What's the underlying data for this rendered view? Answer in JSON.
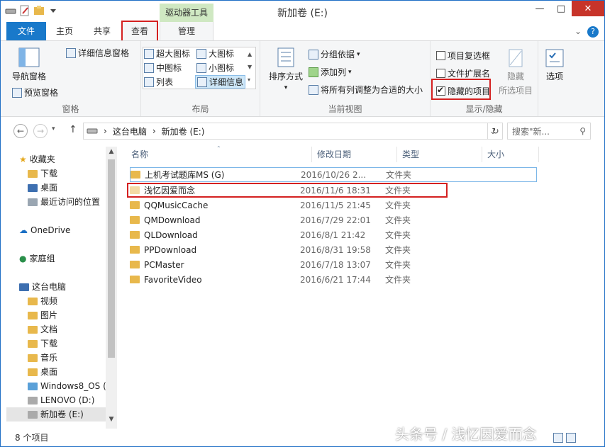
{
  "window": {
    "title": "新加卷 (E:)",
    "context_tab_label": "驱动器工具",
    "minimize": "—",
    "maximize": "□",
    "close": "✕"
  },
  "tabs": {
    "file": "文件",
    "home": "主页",
    "share": "共享",
    "view": "查看",
    "manage": "管理",
    "expand": "⌄",
    "help": "?"
  },
  "ribbon": {
    "panes": {
      "nav_pane": "导航窗格",
      "preview_pane": "预览窗格",
      "details_pane": "详细信息窗格",
      "group": "窗格"
    },
    "layout": {
      "extra_large": "超大图标",
      "large": "大图标",
      "medium": "中图标",
      "small": "小图标",
      "list": "列表",
      "details": "详细信息",
      "group": "布局"
    },
    "current_view": {
      "sort_by": "排序方式",
      "group_by": "分组依据",
      "add_column": "添加列",
      "size_all": "将所有列调整为合适的大小",
      "group": "当前视图"
    },
    "show_hide": {
      "item_checkboxes": "项目复选框",
      "file_extensions": "文件扩展名",
      "hidden_items": "隐藏的项目",
      "hide": "隐藏",
      "selected_items": "所选项目",
      "group": "显示/隐藏",
      "item_checkboxes_checked": false,
      "file_extensions_checked": false,
      "hidden_items_checked": true
    },
    "options": "选项"
  },
  "address": {
    "back": "←",
    "forward": "→",
    "up": "↑",
    "path_root": "这台电脑",
    "path_drive": "新加卷 (E:)",
    "sep": "›",
    "dropdown": "⌄",
    "refresh": "↻",
    "search_placeholder": "搜索\"新...",
    "search_icon": "⚲"
  },
  "nav": {
    "favorites": "收藏夹",
    "downloads": "下载",
    "desktop": "桌面",
    "recent": "最近访问的位置",
    "onedrive": "OneDrive",
    "homegroup": "家庭组",
    "thispc": "这台电脑",
    "videos": "视频",
    "pictures": "图片",
    "documents": "文档",
    "downloads2": "下载",
    "music": "音乐",
    "desktop2": "桌面",
    "win8": "Windows8_OS (",
    "lenovo": "LENOVO (D:)",
    "newvol": "新加卷 (E:)"
  },
  "columns": {
    "name": "名称",
    "date": "修改日期",
    "type": "类型",
    "size": "大小"
  },
  "files": [
    {
      "name": "上机考试题库MS (G)",
      "date": "2016/10/26 2...",
      "type": "文件夹"
    },
    {
      "name": "浅忆因爱而念",
      "date": "2016/11/6 18:31",
      "type": "文件夹"
    },
    {
      "name": "QQMusicCache",
      "date": "2016/11/5 21:45",
      "type": "文件夹"
    },
    {
      "name": "QMDownload",
      "date": "2016/7/29 22:01",
      "type": "文件夹"
    },
    {
      "name": "QLDownload",
      "date": "2016/8/1 21:42",
      "type": "文件夹"
    },
    {
      "name": "PPDownload",
      "date": "2016/8/31 19:58",
      "type": "文件夹"
    },
    {
      "name": "PCMaster",
      "date": "2016/7/18 13:07",
      "type": "文件夹"
    },
    {
      "name": "FavoriteVideo",
      "date": "2016/6/21 17:44",
      "type": "文件夹"
    }
  ],
  "status": {
    "count": "8 个项目"
  },
  "watermark": "头条号 / 浅忆因爱而念"
}
